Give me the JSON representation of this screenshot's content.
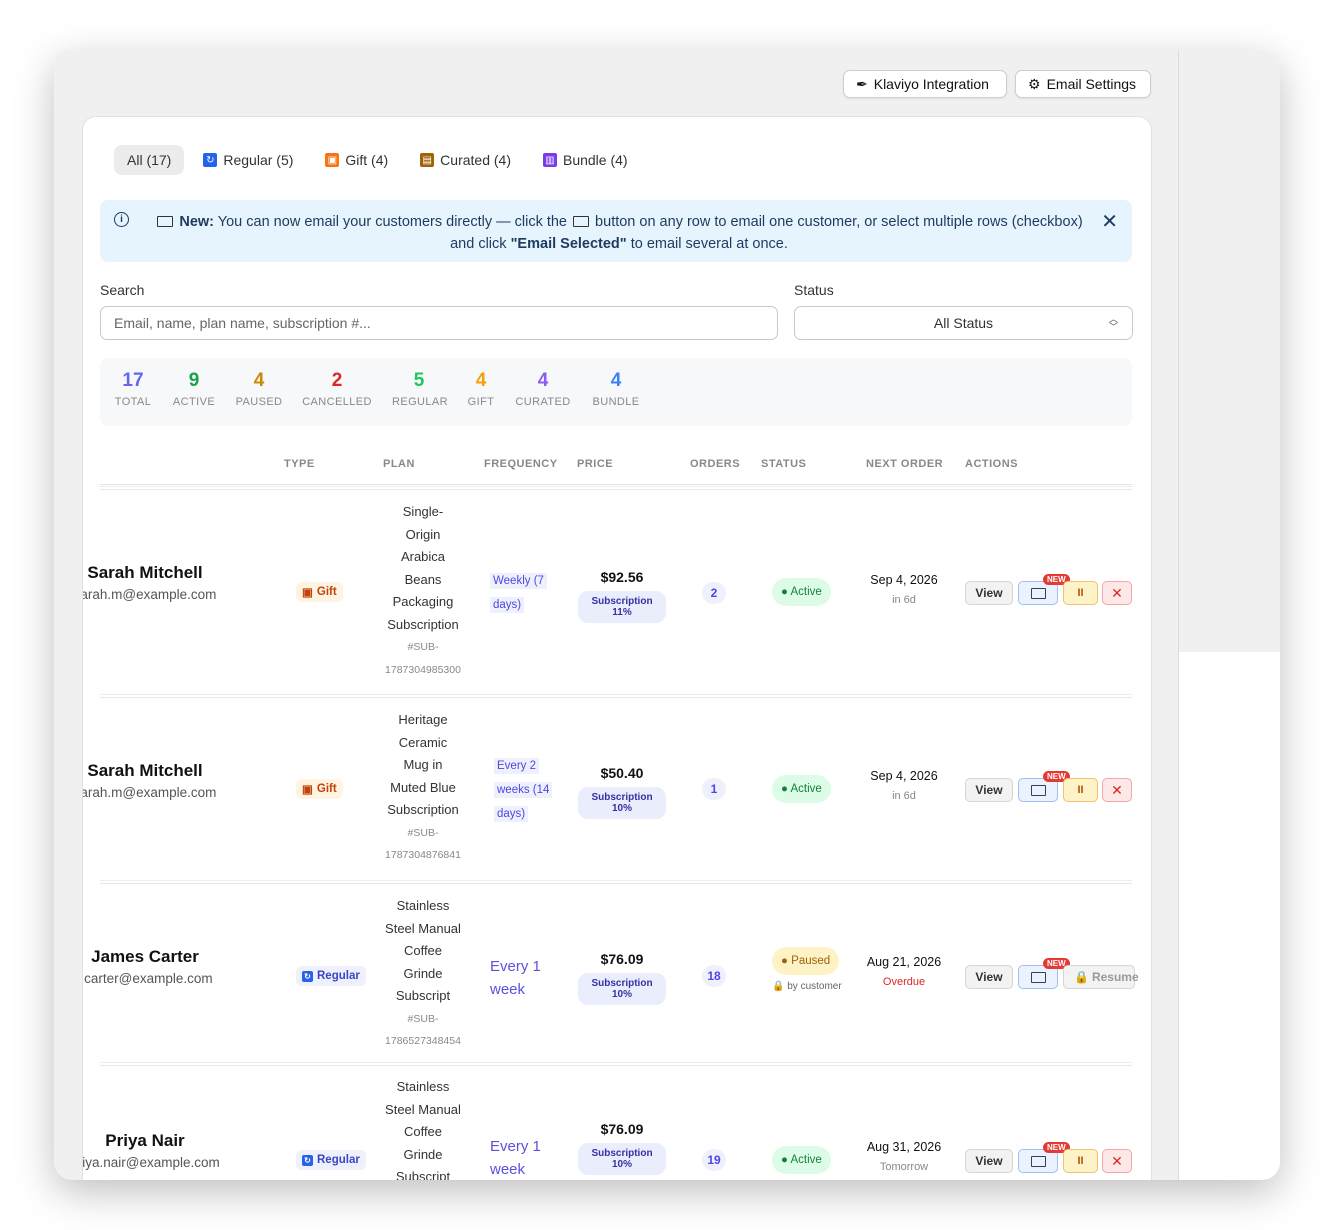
{
  "toolbar": {
    "klaviyo_label": "Klaviyo Integration",
    "email_settings_label": "Email Settings"
  },
  "tabs": [
    {
      "label": "All (17)",
      "icon": "none"
    },
    {
      "label": "Regular (5)",
      "icon": "refresh-icon"
    },
    {
      "label": "Gift (4)",
      "icon": "gift-icon"
    },
    {
      "label": "Curated (4)",
      "icon": "box-icon"
    },
    {
      "label": "Bundle (4)",
      "icon": "bundle-icon"
    }
  ],
  "banner": {
    "new_label": "New:",
    "text1": " You can now email your customers directly — click the ",
    "text2": " button on any row to email one customer, or select multiple rows (checkbox) and click ",
    "email_selected": "\"Email Selected\"",
    "text3": " to email several at once."
  },
  "filters": {
    "search_label": "Search",
    "search_placeholder": "Email, name, plan name, subscription #...",
    "status_label": "Status",
    "status_value": "All Status"
  },
  "stats": [
    {
      "value": "17",
      "label": "TOTAL",
      "color": "#6366f1"
    },
    {
      "value": "9",
      "label": "ACTIVE",
      "color": "#16a34a"
    },
    {
      "value": "4",
      "label": "PAUSED",
      "color": "#ca8a04"
    },
    {
      "value": "2",
      "label": "CANCELLED",
      "color": "#dc2626"
    },
    {
      "value": "5",
      "label": "REGULAR",
      "color": "#22c55e"
    },
    {
      "value": "4",
      "label": "GIFT",
      "color": "#f59e0b"
    },
    {
      "value": "4",
      "label": "CURATED",
      "color": "#8b5cf6"
    },
    {
      "value": "4",
      "label": "BUNDLE",
      "color": "#3b82f6"
    }
  ],
  "columns": [
    "TYPE",
    "PLAN",
    "FREQUENCY",
    "PRICE",
    "ORDERS",
    "STATUS",
    "NEXT ORDER",
    "ACTIONS"
  ],
  "rows": [
    {
      "name": "Sarah Mitchell",
      "email": "sarah.m@example.com",
      "type": "Gift",
      "plan": [
        "Single-",
        "Origin",
        "Arabica",
        "Beans",
        "Packaging",
        "Subscription"
      ],
      "sub_id": [
        "#SUB-",
        "1787304985300"
      ],
      "frequency": [
        "Weekly (7",
        "days)"
      ],
      "price": "$92.56",
      "discount": "Subscription 11%",
      "orders": "2",
      "status": "Active",
      "status_by": "",
      "next_date": "Sep 4, 2026",
      "next_sub": "in 6d"
    },
    {
      "name": "Sarah Mitchell",
      "email": "sarah.m@example.com",
      "type": "Gift",
      "plan": [
        "Heritage",
        "Ceramic",
        "Mug in",
        "Muted Blue",
        "Subscription"
      ],
      "sub_id": [
        "#SUB-",
        "1787304876841"
      ],
      "frequency": [
        "Every 2",
        "weeks (14",
        "days)"
      ],
      "price": "$50.40",
      "discount": "Subscription 10%",
      "orders": "1",
      "status": "Active",
      "status_by": "",
      "next_date": "Sep 4, 2026",
      "next_sub": "in 6d"
    },
    {
      "name": "James Carter",
      "email": "j.carter@example.com",
      "type": "Regular",
      "plan": [
        "Stainless",
        "Steel Manual",
        "Coffee",
        "Grinde",
        "Subscript"
      ],
      "sub_id": [
        "#SUB-",
        "1786527348454"
      ],
      "frequency": [
        "Every 1",
        "week"
      ],
      "price": "$76.09",
      "discount": "Subscription 10%",
      "orders": "18",
      "status": "Paused",
      "status_by": "by customer",
      "next_date": "Aug 21, 2026",
      "next_sub": "Overdue"
    },
    {
      "name": "Priya Nair",
      "email": "priya.nair@example.com",
      "type": "Regular",
      "plan": [
        "Stainless",
        "Steel Manual",
        "Coffee",
        "Grinde",
        "Subscript"
      ],
      "sub_id": [],
      "frequency": [
        "Every 1",
        "week"
      ],
      "price": "$76.09",
      "discount": "Subscription 10%",
      "orders": "19",
      "status": "Active",
      "status_by": "",
      "next_date": "Aug 31, 2026",
      "next_sub": "Tomorrow"
    }
  ],
  "actions": {
    "view": "View",
    "new": "NEW",
    "pause": "II",
    "cancel": "✕",
    "resume": "Resume"
  }
}
